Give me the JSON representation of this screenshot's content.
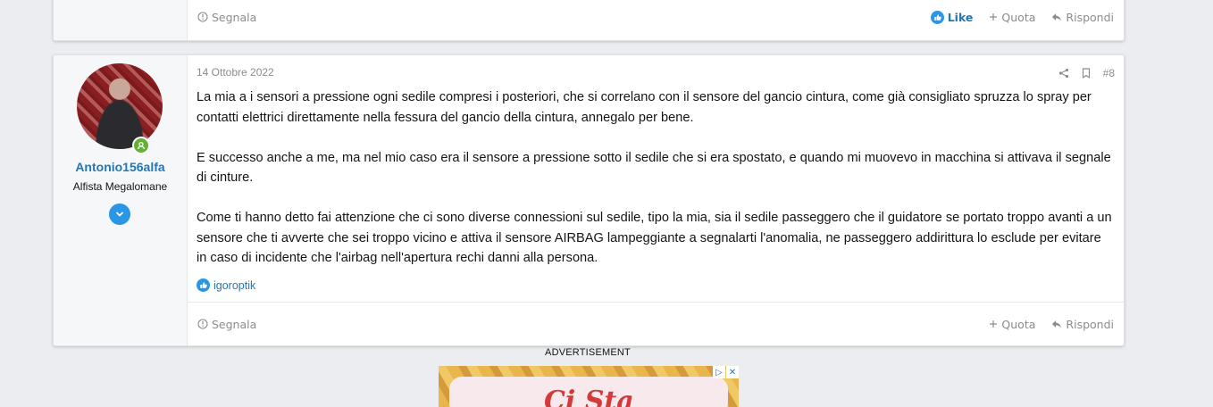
{
  "previous_post": {
    "report_label": "Segnala",
    "like_label": "Like",
    "quote_label": "Quota",
    "reply_label": "Rispondi"
  },
  "post": {
    "author": {
      "username": "Antonio156alfa",
      "title": "Alfista Megalomane"
    },
    "date": "14 Ottobre 2022",
    "post_number": "#8",
    "paragraphs": [
      "La mia a i sensori a pressione ogni sedile compresi i posteriori, che si correlano con il sensore del gancio cintura, come già consigliato spruzza lo spray per contatti elettrici direttamente nella fessura del gancio della cintura, annegalo per bene.",
      "E successo anche a me, ma nel mio caso era il sensore a pressione sotto il sedile che si era spostato, e quando mi muovevo in macchina si attivava il segnale di cinture.",
      "Come ti hanno detto fai attenzione che ci sono diverse connessioni sul sedile, tipo la mia, sia il sedile passeggero che il guidatore se portato troppo avanti a un sensore che ti avverte che sei troppo vicino e attiva il sensore AIRBAG lampeggiante a segnalarti l'anomalia, ne passeggero addirittura lo esclude per evitare in caso di incidente che l'airbag nell'apertura rechi danni alla persona."
    ],
    "liked_by": "igoroptik",
    "report_label": "Segnala",
    "quote_label": "Quota",
    "reply_label": "Rispondi"
  },
  "ad": {
    "label": "ADVERTISEMENT",
    "headline": "Ci Sta",
    "adchoices_glyph": "▷",
    "close_glyph": "✕"
  },
  "colors": {
    "link": "#2577b1",
    "online": "#63b132",
    "expand": "#2b95e6"
  }
}
